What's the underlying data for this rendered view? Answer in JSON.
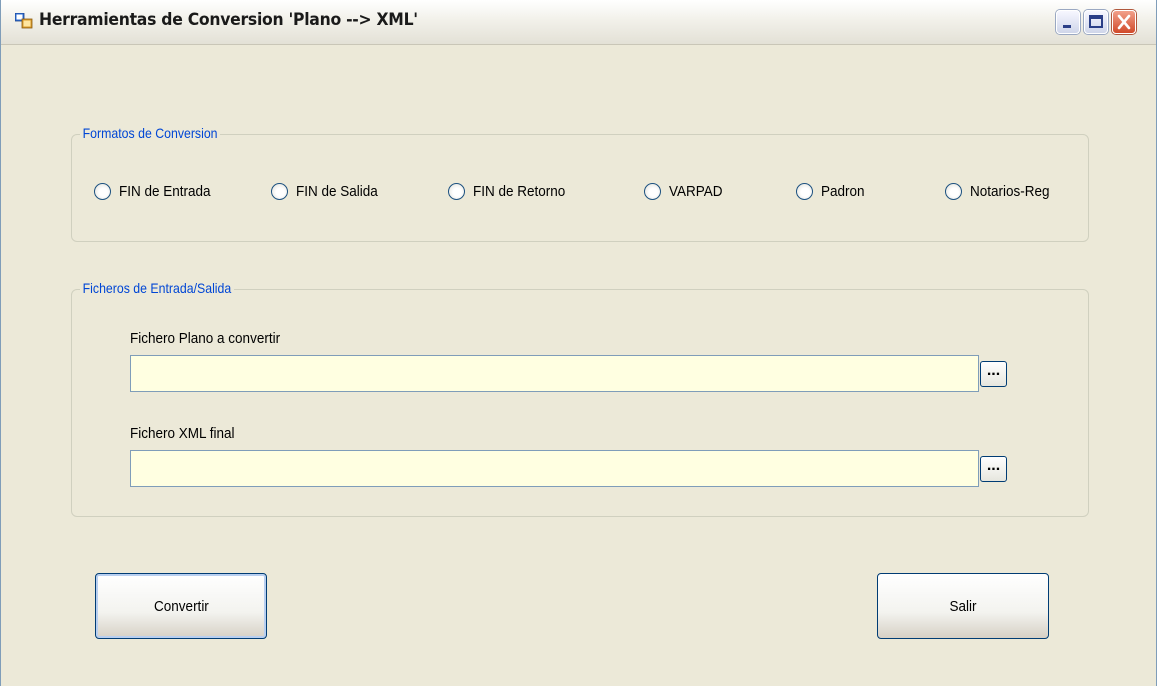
{
  "window": {
    "title": "Herramientas de Conversion  'Plano --> XML'",
    "controls": {
      "minimize": "minimize-icon",
      "maximize": "maximize-icon",
      "close": "close-icon"
    }
  },
  "formatos": {
    "legend": "Formatos de Conversion",
    "options": [
      {
        "label": "FIN de Entrada",
        "selected": false
      },
      {
        "label": "FIN de Salida",
        "selected": false
      },
      {
        "label": "FIN de Retorno",
        "selected": false
      },
      {
        "label": "VARPAD",
        "selected": false
      },
      {
        "label": "Padron",
        "selected": false
      },
      {
        "label": "Notarios-Reg",
        "selected": false
      }
    ]
  },
  "ficheros": {
    "legend": "Ficheros de Entrada/Salida",
    "input": {
      "label": "Fichero Plano a convertir",
      "value": "",
      "browse_label": "..."
    },
    "output": {
      "label": "Fichero XML final",
      "value": "",
      "browse_label": "..."
    }
  },
  "buttons": {
    "convertir": "Convertir",
    "salir": "Salir"
  },
  "colors": {
    "legend": "#0046d5",
    "textbox_bg": "#ffffe1",
    "window_bg": "#ece9d8"
  }
}
